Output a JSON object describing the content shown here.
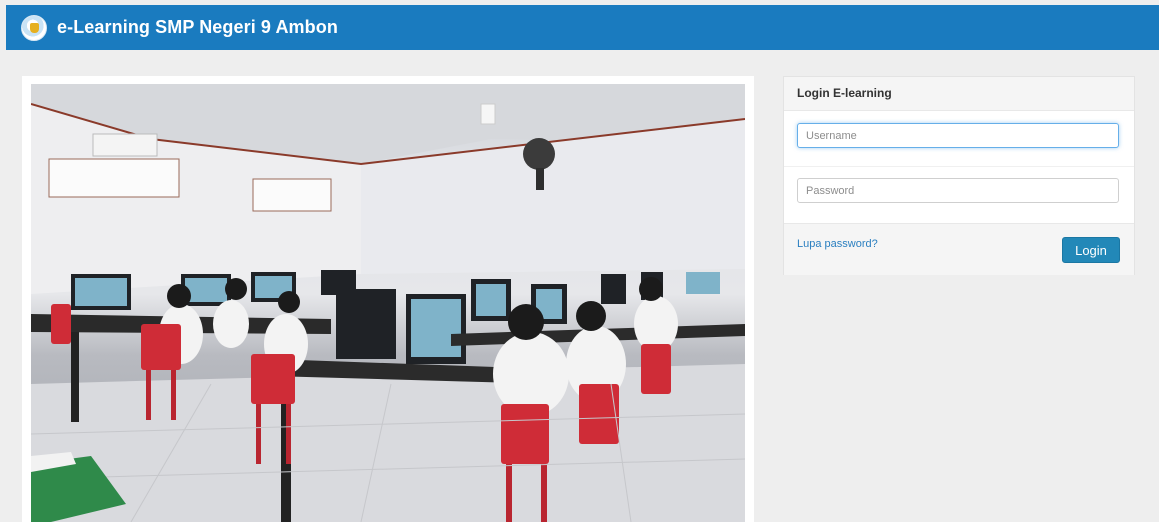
{
  "header": {
    "title": "e-Learning SMP Negeri 9 Ambon",
    "logo_icon": "school-emblem-icon",
    "background_color": "#1a7bbf"
  },
  "photo": {
    "description_icon": "classroom-computer-lab-photo"
  },
  "login": {
    "title": "Login E-learning",
    "username": {
      "value": "",
      "placeholder": "Username"
    },
    "password": {
      "value": "",
      "placeholder": "Password"
    },
    "forgot_label": "Lupa password?",
    "submit_label": "Login",
    "accent_color": "#2288b8",
    "link_color": "#2a7fc0"
  }
}
